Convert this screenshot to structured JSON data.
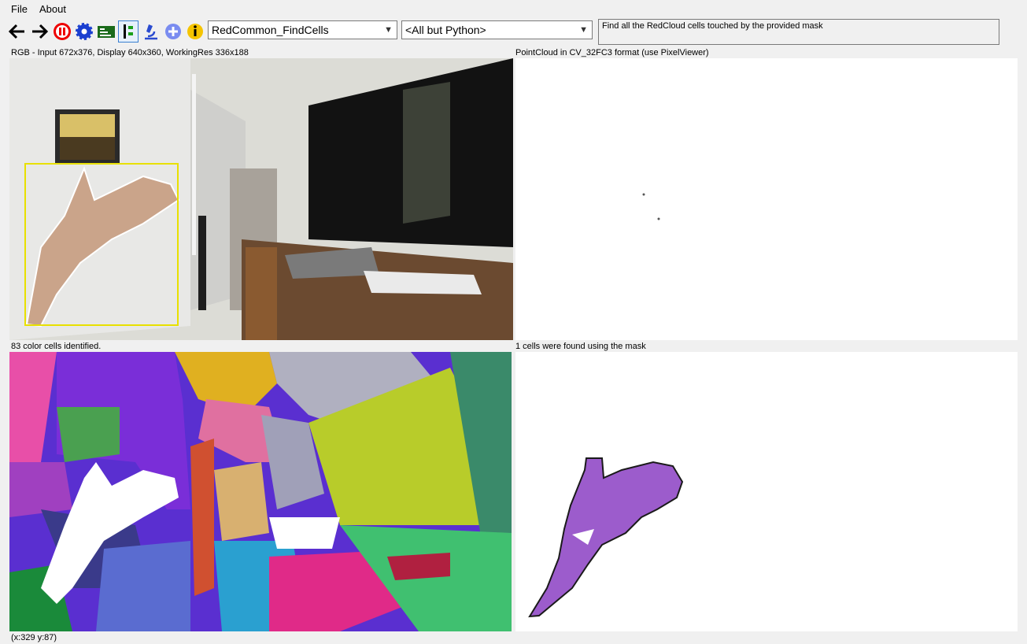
{
  "menu": {
    "file": "File",
    "about": "About"
  },
  "toolbar": {
    "algorithm": "RedCommon_FindCells",
    "group": "<All but Python>",
    "description": "Find all the RedCloud cells touched by the provided mask",
    "icons": [
      "back-arrow-icon",
      "forward-arrow-icon",
      "pause-icon",
      "settings-gear-icon",
      "chart-icon",
      "options-icon",
      "microscope-icon",
      "add-icon",
      "info-icon"
    ]
  },
  "panels": {
    "top_left_label": "RGB - Input 672x376, Display 640x360, WorkingRes 336x188",
    "top_right_label": "PointCloud in CV_32FC3 format (use PixelViewer)",
    "bottom_left_label": "83 color cells identified.",
    "bottom_right_label": "1 cells were found using the mask"
  },
  "status": "(x:329 y:87)",
  "colors": {
    "highlight_box": "#e8e000",
    "cell_purple": "#9c5ccc",
    "window_bg": "#f0f0f0"
  }
}
